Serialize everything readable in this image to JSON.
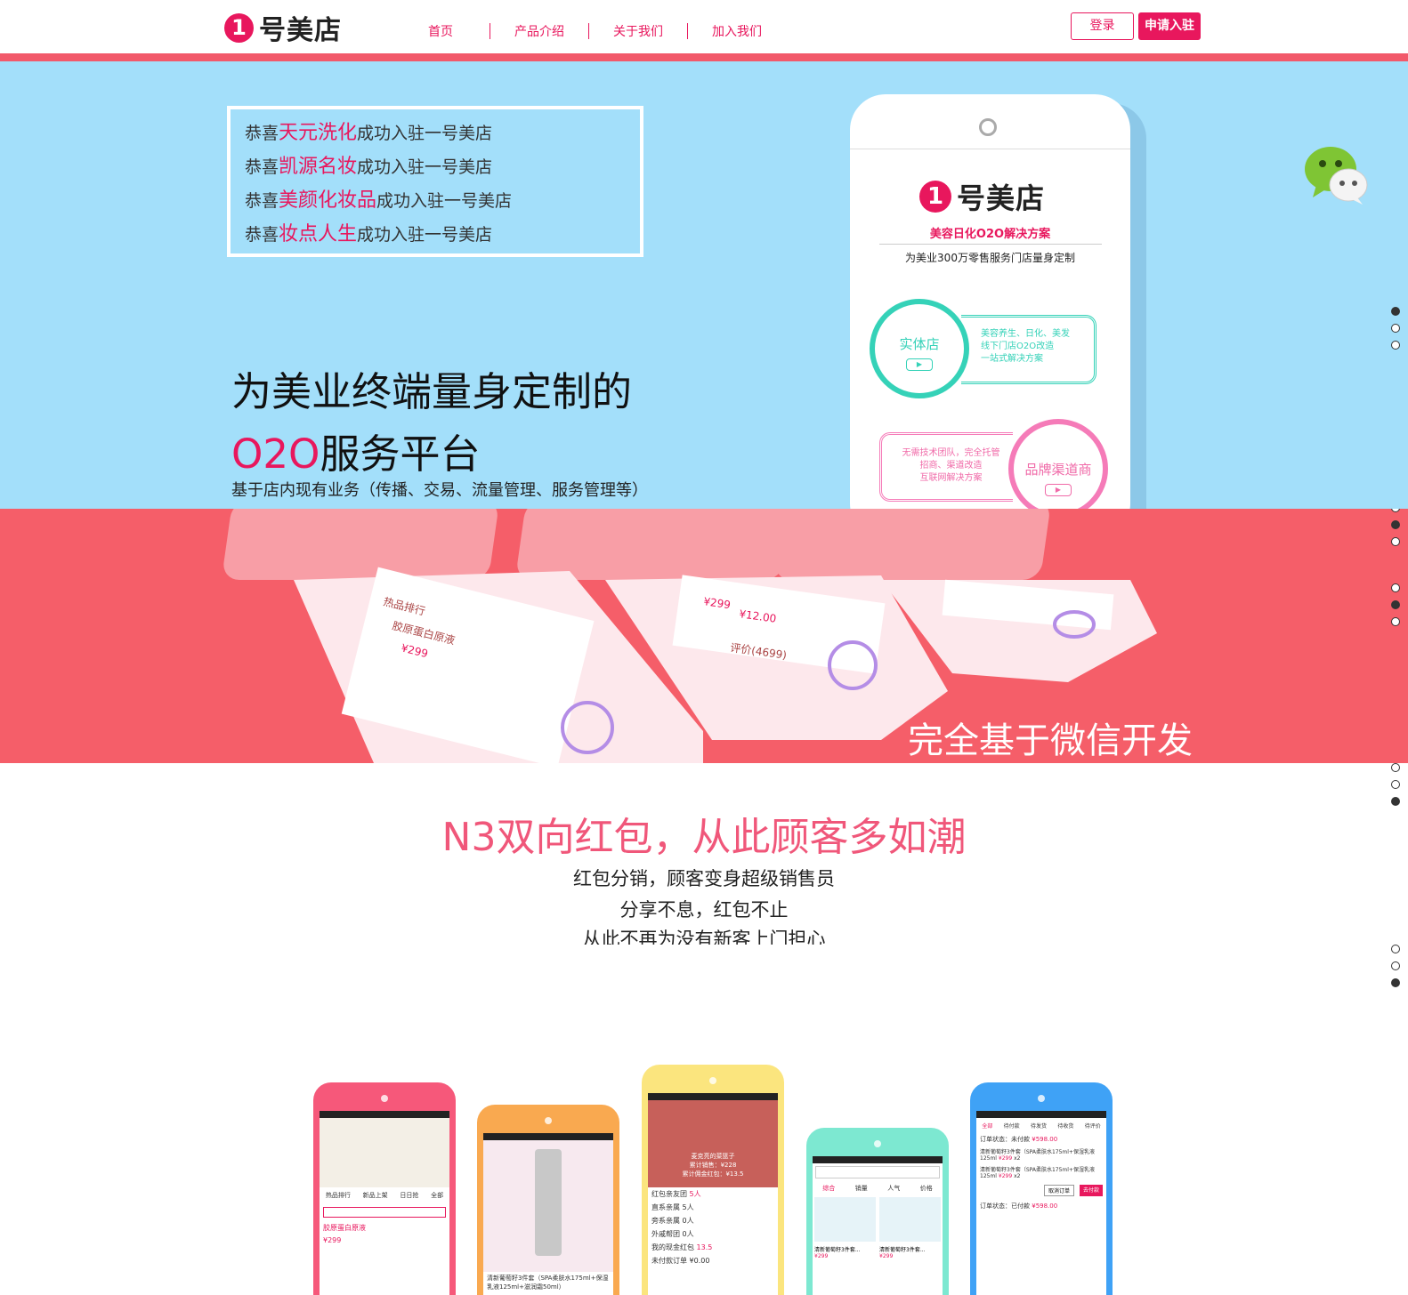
{
  "header": {
    "logo_mark": "1",
    "logo_text": "号美店",
    "nav": [
      "首页",
      "产品介绍",
      "关于我们",
      "加入我们"
    ],
    "login_label": "登录",
    "apply_label": "申请入驻"
  },
  "hero": {
    "notices": [
      {
        "prefix": "恭喜",
        "name": "天元洗化",
        "suffix": "成功入驻一号美店"
      },
      {
        "prefix": "恭喜",
        "name": "凯源名妆",
        "suffix": "成功入驻一号美店"
      },
      {
        "prefix": "恭喜",
        "name": "美颜化妆品",
        "suffix": "成功入驻一号美店"
      },
      {
        "prefix": "恭喜",
        "name": "妆点人生",
        "suffix": "成功入驻一号美店"
      }
    ],
    "title_line1": "为美业终端量身定制的",
    "title_line2_highlight": "O2O",
    "title_line2_rest": "服务平台",
    "subtitle": "基于店内现有业务（传播、交易、流量管理、服务管理等）",
    "phone": {
      "logo_mark": "1",
      "logo_text": "号美店",
      "tag1": "美容日化O2O解决方案",
      "tag2": "为美业300万零售服务门店量身定制",
      "circle1_label": "实体店",
      "card1_lines": [
        "美容养生、日化、美发",
        "线下门店O2O改造",
        "一站式解决方案"
      ],
      "circle2_label": "品牌渠道商",
      "card2_lines": [
        "无需技术团队，完全托管",
        "招商、渠道改造",
        "互联网解决方案"
      ]
    }
  },
  "band": {
    "caption": "完全基于微信开发",
    "phone_texts": [
      "热品排行",
      "胶原蛋白原液",
      "¥299",
      "¥299",
      "¥12.00",
      "评价(4699)"
    ]
  },
  "section3": {
    "title": "N3双向红包，从此顾客多如潮",
    "lines": [
      "红包分销，顾客变身超级销售员",
      "分享不息，红包不止",
      "从此不再为没有新客上门担心"
    ]
  },
  "mockups": [
    {
      "color": "#f6587a",
      "texts": [
        "热品排行",
        "新品上架",
        "日日抢",
        "全部",
        "胶原蛋白原液",
        "¥299"
      ]
    },
    {
      "color": "#f9a950",
      "texts": [
        "清新葡萄籽3件套（SPA柔肤水175ml+保湿乳液125ml+滋润霜50ml）"
      ]
    },
    {
      "color": "#fbe57e",
      "texts": [
        "麦克亮的菜篮子",
        "累计销售：¥228",
        "累计佣金红包：¥13.5",
        "红包亲友团",
        "5人",
        "直系亲属",
        "5人",
        "旁系亲属",
        "0人",
        "外戚帮团",
        "0人",
        "我的现金红包",
        "13.5",
        "未付款订单",
        "¥0.00"
      ]
    },
    {
      "color": "#7de8d1",
      "texts": [
        "综合",
        "销量",
        "人气",
        "价格",
        "清新葡萄籽3件套...",
        "¥299",
        "清新葡萄籽3件套...",
        "¥299"
      ]
    },
    {
      "color": "#3fa2f6",
      "texts": [
        "全部",
        "待付款",
        "待发货",
        "待收货",
        "待评价",
        "订单状态：未付款",
        "¥598.00",
        "清新葡萄籽3件套（SPA柔肤水175ml+保湿乳液125ml",
        "¥299",
        "x2",
        "清新葡萄籽3件套（SPA柔肤水175ml+保湿乳液125ml",
        "¥299",
        "x2",
        "取消订单",
        "去付款",
        "订单状态：已付款",
        "¥598.00"
      ]
    }
  ],
  "dots_groups": [
    {
      "active": 0
    },
    {
      "active": 1
    },
    {
      "active": 2
    },
    {
      "active": 2
    },
    {
      "active": 2
    }
  ],
  "colors": {
    "brand_pink": "#e8175d",
    "hero_blue": "#a3dffa",
    "band_red": "#f55e69"
  },
  "icons": {
    "wechat": "wechat-icon"
  }
}
